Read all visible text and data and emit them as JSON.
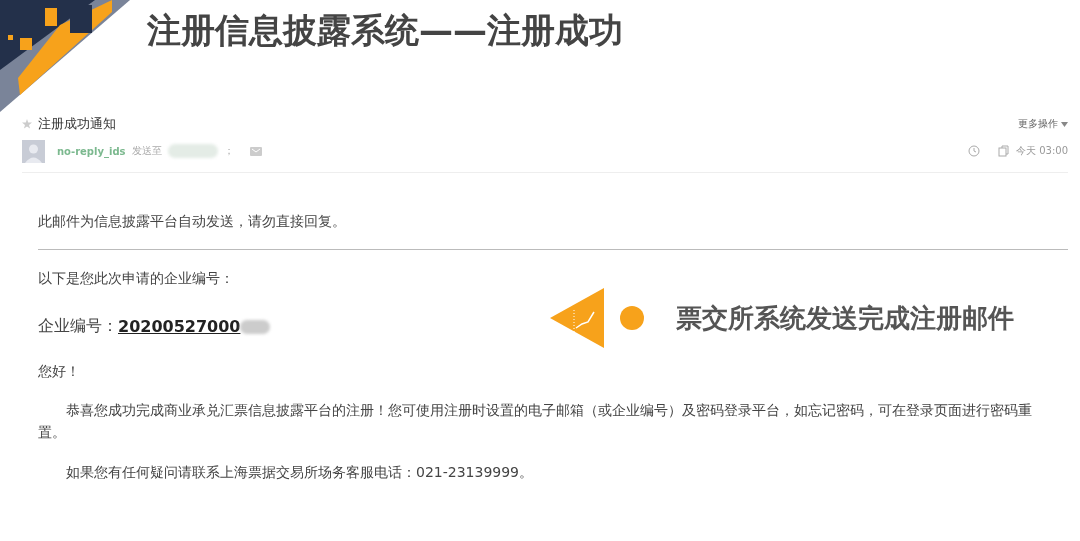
{
  "slide_title": "注册信息披露系统——注册成功",
  "email": {
    "subject": "注册成功通知",
    "starred": false,
    "sender": "no-reply_ids",
    "sent_to_label": "发送至",
    "recipient_separator": "；",
    "more_actions": "更多操作",
    "time": "今天 03:00",
    "notice": "此邮件为信息披露平台自动发送，请勿直接回复。",
    "intro": "以下是您此次申请的企业编号：",
    "company_id_label": "企业编号：",
    "company_id": "20200527000",
    "greeting": "您好！",
    "paragraphs": [
      "恭喜您成功完成商业承兑汇票信息披露平台的注册！您可使用注册时设置的电子邮箱（或企业编号）及密码登录平台，如忘记密码，可在登录页面进行密码重置。",
      "如果您有任何疑问请联系上海票据交易所场务客服电话：021-23139999。"
    ]
  },
  "callout": {
    "text": "票交所系统发送完成注册邮件"
  }
}
